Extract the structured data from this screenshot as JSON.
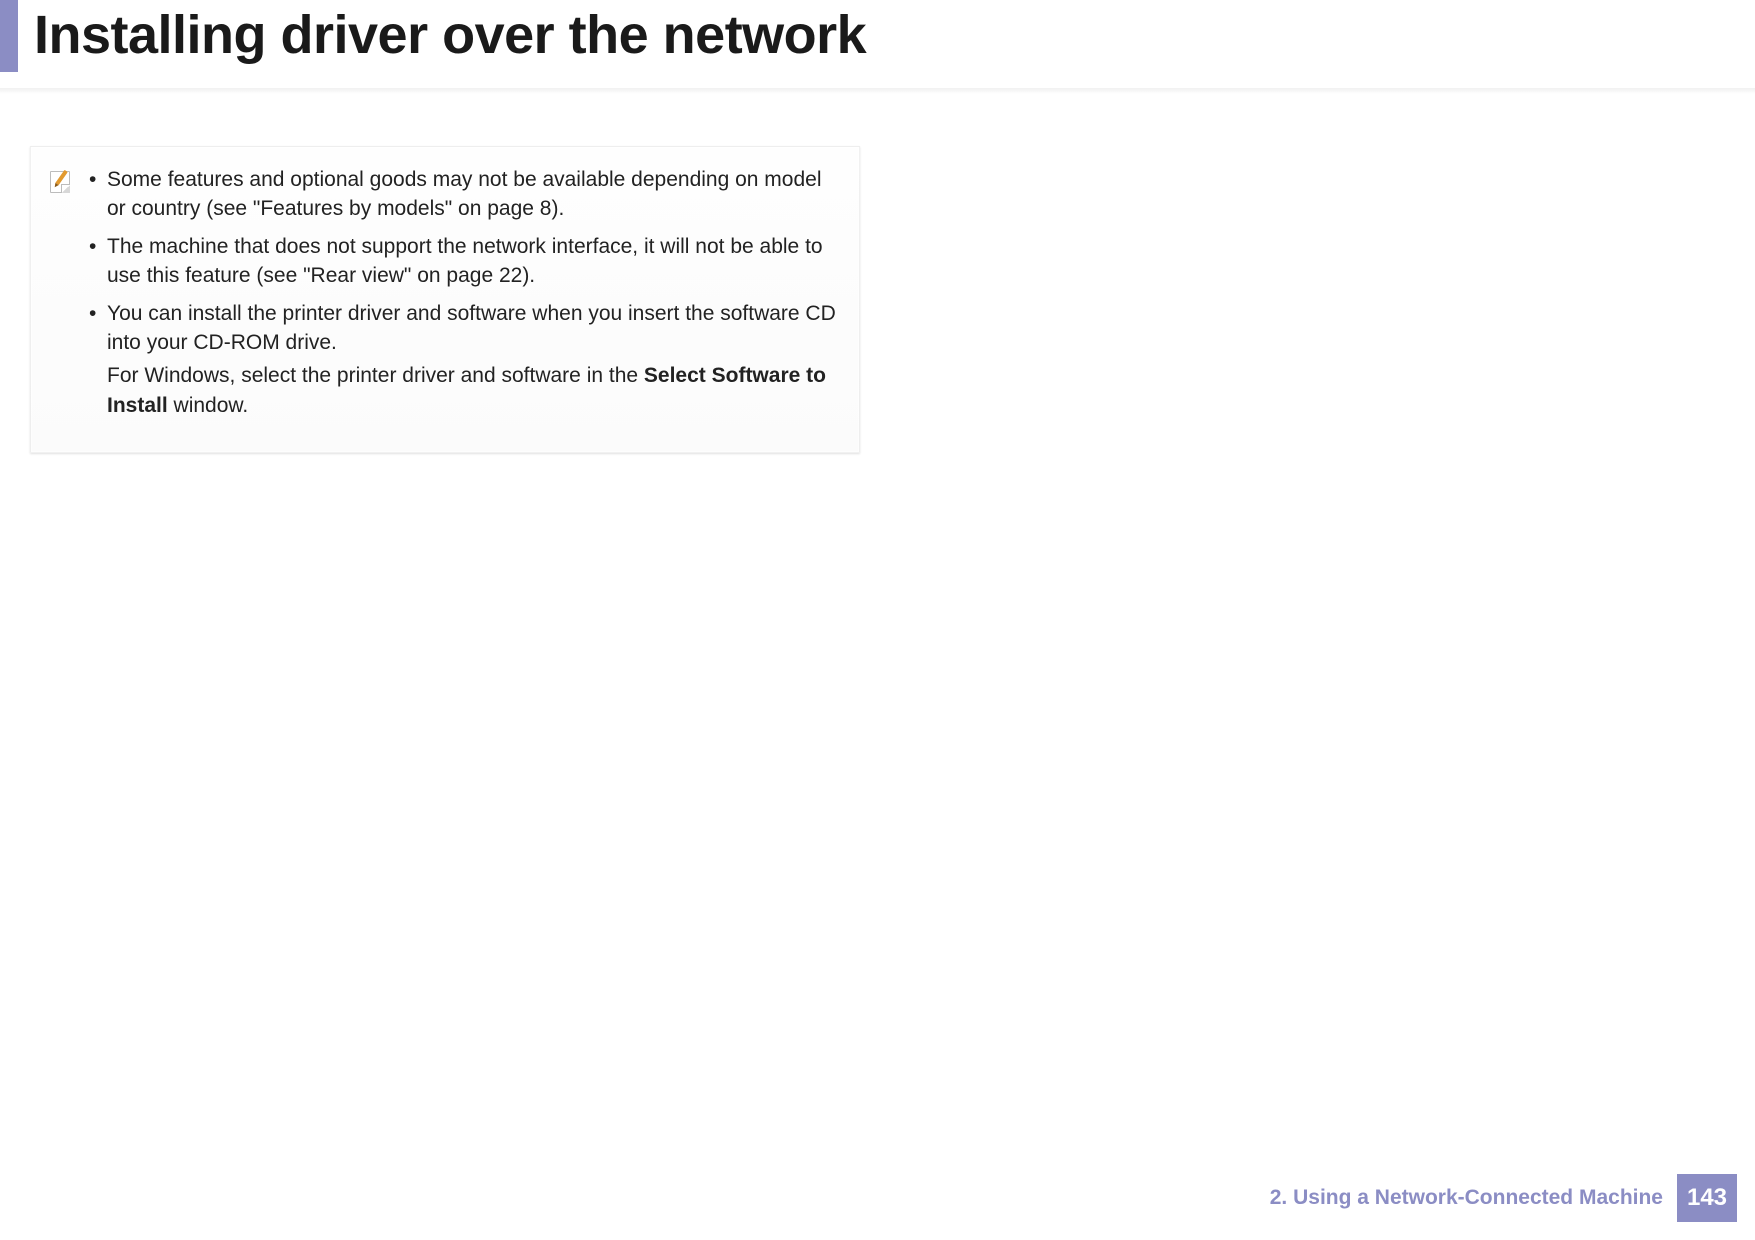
{
  "header": {
    "title": "Installing driver over the network"
  },
  "note": {
    "bullets": [
      {
        "text": "Some features and optional goods may not be available depending on model or country (see \"Features by models\" on page 8)."
      },
      {
        "text": "The machine that does not support the network interface, it will not be able to use this feature (see \"Rear view\" on page 22)."
      },
      {
        "text": " You can install the printer driver and software when you insert the software CD into your CD-ROM drive.",
        "extra_pre": "For Windows, select the printer driver and software in the ",
        "extra_bold": "Select Software to Install",
        "extra_post": " window."
      }
    ]
  },
  "footer": {
    "chapter": "2.  Using a Network-Connected Machine",
    "page_number": "143"
  }
}
